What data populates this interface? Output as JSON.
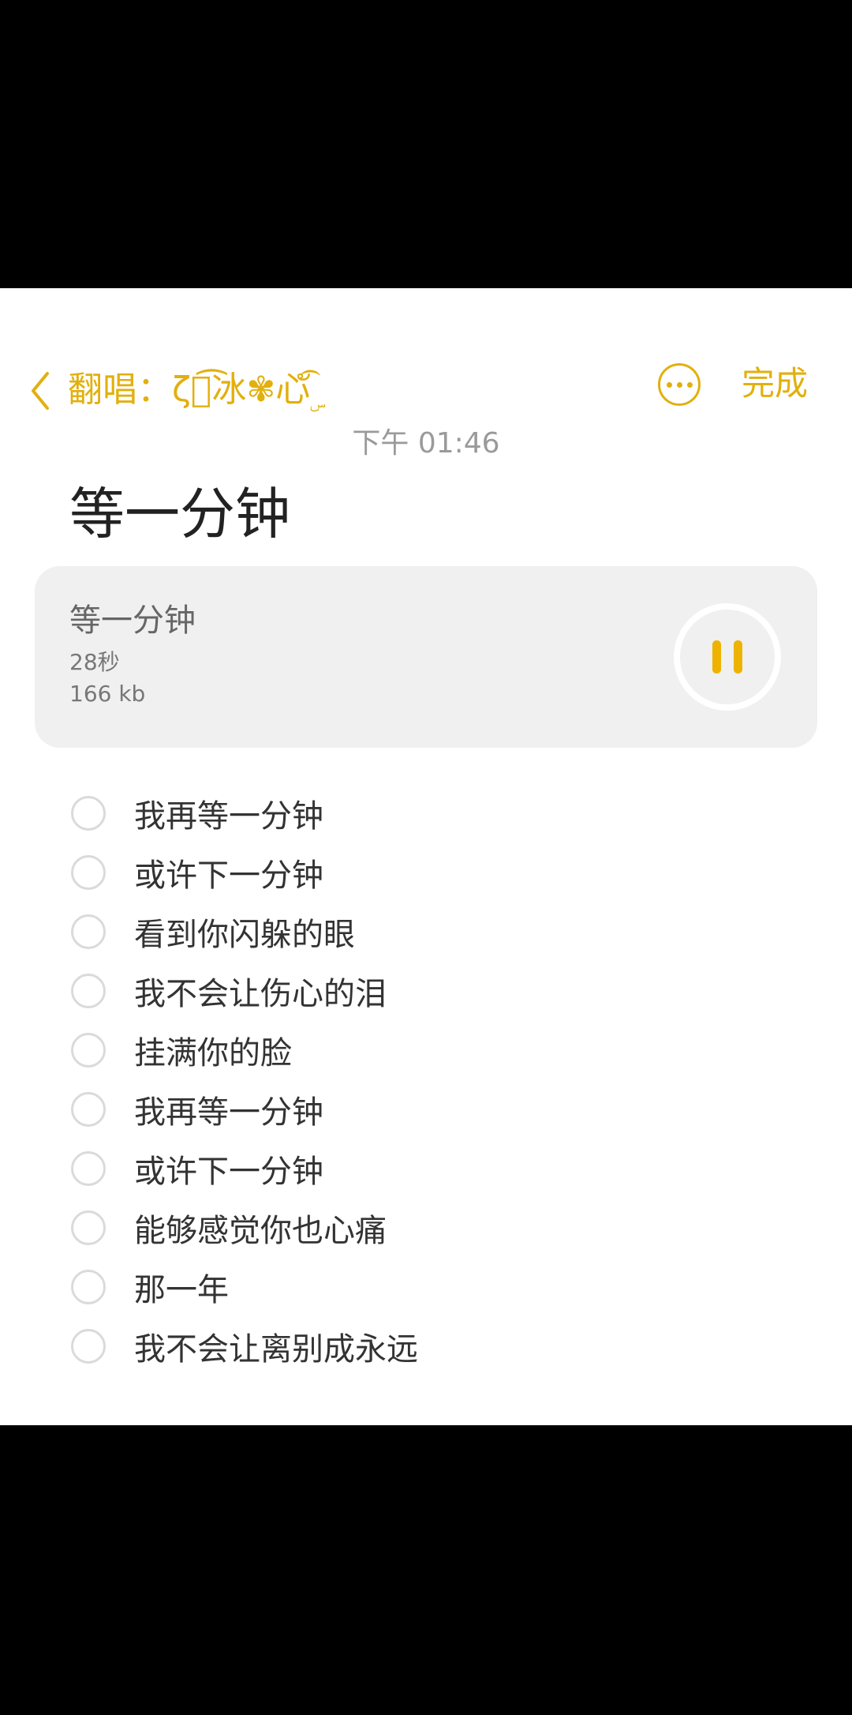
{
  "header": {
    "back_icon": "chevron-left-icon",
    "title": "翻唱：ζั͡冰✾心ัۣ͡",
    "more_icon": "more-horizontal-circle-icon",
    "done_label": "完成",
    "accent_color": "#e2b00d"
  },
  "note": {
    "timestamp": "下午 01:46",
    "title": "等一分钟"
  },
  "audio": {
    "name": "等一分钟",
    "duration": "28秒",
    "size": "166 kb",
    "control_icon": "pause-icon",
    "playing": true
  },
  "checklist": [
    {
      "text": "我再等一分钟",
      "checked": false
    },
    {
      "text": "或许下一分钟",
      "checked": false
    },
    {
      "text": "看到你闪躲的眼",
      "checked": false
    },
    {
      "text": "我不会让伤心的泪",
      "checked": false
    },
    {
      "text": "挂满你的脸",
      "checked": false
    },
    {
      "text": "我再等一分钟",
      "checked": false
    },
    {
      "text": "或许下一分钟",
      "checked": false
    },
    {
      "text": "能够感觉你也心痛",
      "checked": false
    },
    {
      "text": "那一年",
      "checked": false
    },
    {
      "text": "我不会让离别成永远",
      "checked": false
    }
  ]
}
